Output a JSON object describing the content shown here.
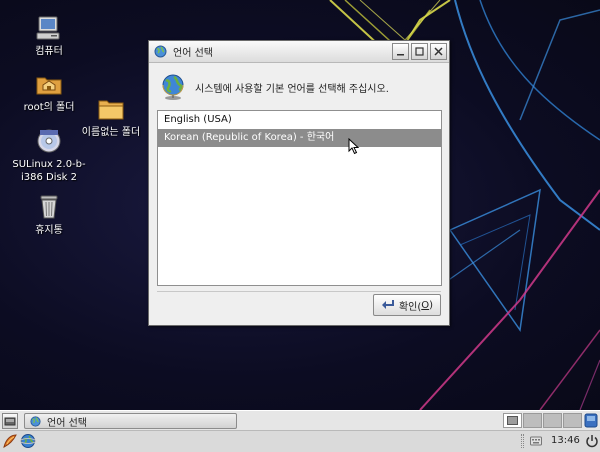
{
  "desktop": {
    "icons": [
      {
        "label": "컴퓨터",
        "icon": "computer-icon"
      },
      {
        "label": "root의 폴더",
        "icon": "home-folder-icon"
      },
      {
        "label": "이름없는 폴더",
        "icon": "folder-icon"
      },
      {
        "label": "SULinux 2.0-b-\ni386 Disk 2",
        "icon": "cdrom-icon"
      },
      {
        "label": "휴지통",
        "icon": "trash-icon"
      }
    ]
  },
  "dialog": {
    "title": "언어 선택",
    "prompt": "시스템에 사용할 기본 언어를 선택해 주십시오.",
    "languages": [
      {
        "label": "English (USA)",
        "selected": false
      },
      {
        "label": "Korean (Republic of Korea) - 한국어",
        "selected": true
      }
    ],
    "ok_label": "확인(",
    "ok_mnemonic": "O",
    "ok_suffix": ")"
  },
  "taskbar": {
    "task_title": "언어 선택",
    "clock": "13:46"
  },
  "colors": {
    "selection": "#8c8c8c",
    "desktop_bg": "#0d0d24",
    "neon_yellow": "#d8d84a",
    "neon_blue": "#3a8fe0",
    "neon_pink": "#d03a8a"
  }
}
